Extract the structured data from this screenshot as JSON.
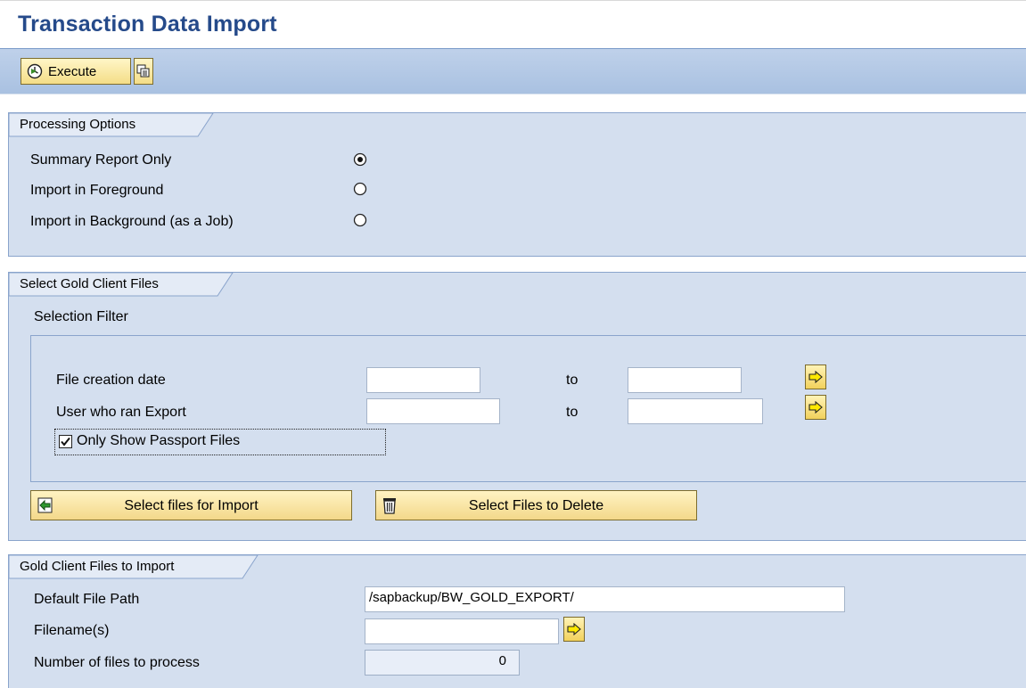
{
  "page": {
    "title": "Transaction Data Import"
  },
  "toolbar": {
    "execute_label": "Execute"
  },
  "processing_options": {
    "title": "Processing Options",
    "options": [
      {
        "label": "Summary Report Only",
        "selected": true
      },
      {
        "label": "Import in Foreground",
        "selected": false
      },
      {
        "label": "Import in Background (as a Job)",
        "selected": false
      }
    ]
  },
  "select_files": {
    "title": "Select Gold Client Files",
    "filter_title": "Selection Filter",
    "rows": [
      {
        "label": "File creation date",
        "from": "",
        "to_label": "to",
        "to": ""
      },
      {
        "label": "User who ran Export",
        "from": "",
        "to_label": "to",
        "to": ""
      }
    ],
    "passport_checkbox": {
      "label": "Only Show Passport Files",
      "checked": true
    },
    "import_button": "Select files for Import",
    "delete_button": "Select Files to Delete"
  },
  "files_to_import": {
    "title": "Gold Client Files to Import",
    "default_path_label": "Default File Path",
    "default_path_value": "/sapbackup/BW_GOLD_EXPORT/",
    "filenames_label": "Filename(s)",
    "filenames_value": "",
    "num_files_label": "Number of files to process",
    "num_files_value": "0"
  },
  "colors": {
    "title": "#254a8a",
    "group_bg": "#d4dfef",
    "toolbar_bg": "#bfd1ea",
    "button_yellow": "#f4dd87"
  }
}
